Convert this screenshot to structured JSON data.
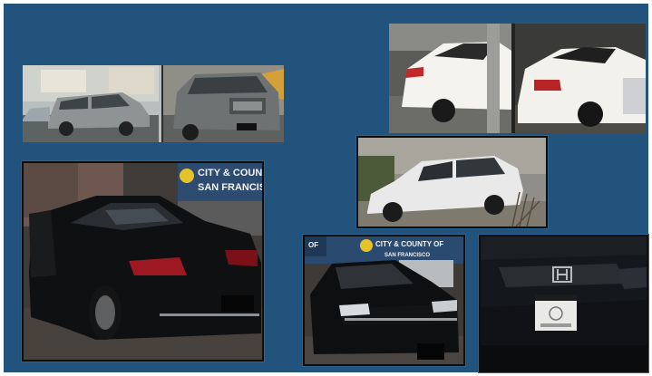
{
  "slide": {
    "background": "#22537d",
    "photos": [
      {
        "id": "nissan-armada-pair",
        "subject": "silver SUVs"
      },
      {
        "id": "white-coupe-pair",
        "subject": "white coupes"
      },
      {
        "id": "black-honda-coupe",
        "subject": "black coupe",
        "sign_line1": "CITY & COUNTY",
        "sign_line2": "SAN FRANCISCO"
      },
      {
        "id": "white-suv",
        "subject": "white SUV"
      },
      {
        "id": "black-honda-sedan",
        "subject": "black sedan",
        "sign_line1": "OF",
        "sign_line2": "CITY & COUNTY OF",
        "sign_line3": "SAN FRANCISCO"
      },
      {
        "id": "honda-front-closeup",
        "subject": "black front bumper"
      }
    ]
  }
}
